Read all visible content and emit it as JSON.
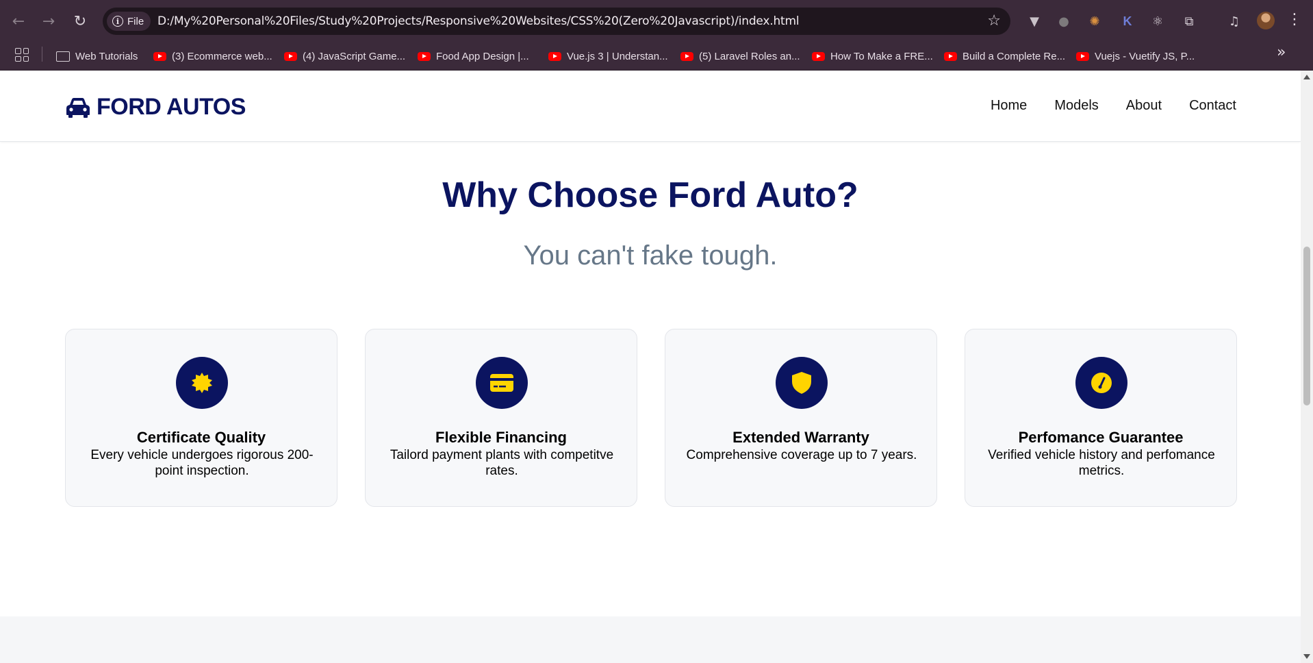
{
  "browser": {
    "file_chip": "File",
    "url": "D:/My%20Personal%20Files/Study%20Projects/Responsive%20Websites/CSS%20(Zero%20Javascript)/index.html",
    "bookmarks": [
      {
        "label": "Web Tutorials",
        "icon": "folder-icon"
      },
      {
        "label": "(3) Ecommerce web...",
        "icon": "youtube-icon"
      },
      {
        "label": "(4) JavaScript Game...",
        "icon": "youtube-icon"
      },
      {
        "label": "Food App Design |...",
        "icon": "youtube-icon"
      },
      {
        "label": "Vue.js 3 | Understan...",
        "icon": "youtube-icon"
      },
      {
        "label": "(5) Laravel Roles an...",
        "icon": "youtube-icon"
      },
      {
        "label": "How To Make a FRE...",
        "icon": "youtube-icon"
      },
      {
        "label": "Build a Complete Re...",
        "icon": "youtube-icon"
      },
      {
        "label": "Vuejs - Vuetify JS, P...",
        "icon": "youtube-icon"
      }
    ]
  },
  "header": {
    "logo_text": "FORD AUTOS",
    "logo_icon": "car-icon",
    "nav": [
      "Home",
      "Models",
      "About",
      "Contact"
    ]
  },
  "section": {
    "title": "Why Choose Ford Auto?",
    "subtitle": "You can't fake tough."
  },
  "features": [
    {
      "icon": "certificate-icon",
      "title": "Certificate Quality",
      "desc": "Every vehicle undergoes rigorous 200-point inspection."
    },
    {
      "icon": "credit-card-icon",
      "title": "Flexible Financing",
      "desc": "Tailord payment plants with competitve rates."
    },
    {
      "icon": "shield-icon",
      "title": "Extended Warranty",
      "desc": "Comprehensive coverage up to 7 years."
    },
    {
      "icon": "gauge-icon",
      "title": "Perfomance Guarantee",
      "desc": "Verified vehicle history and perfomance metrics."
    }
  ],
  "colors": {
    "brand": "#0b1460",
    "accent_icon": "#ffd400",
    "subtitle": "#667788",
    "card_bg": "#f7f8fa"
  }
}
